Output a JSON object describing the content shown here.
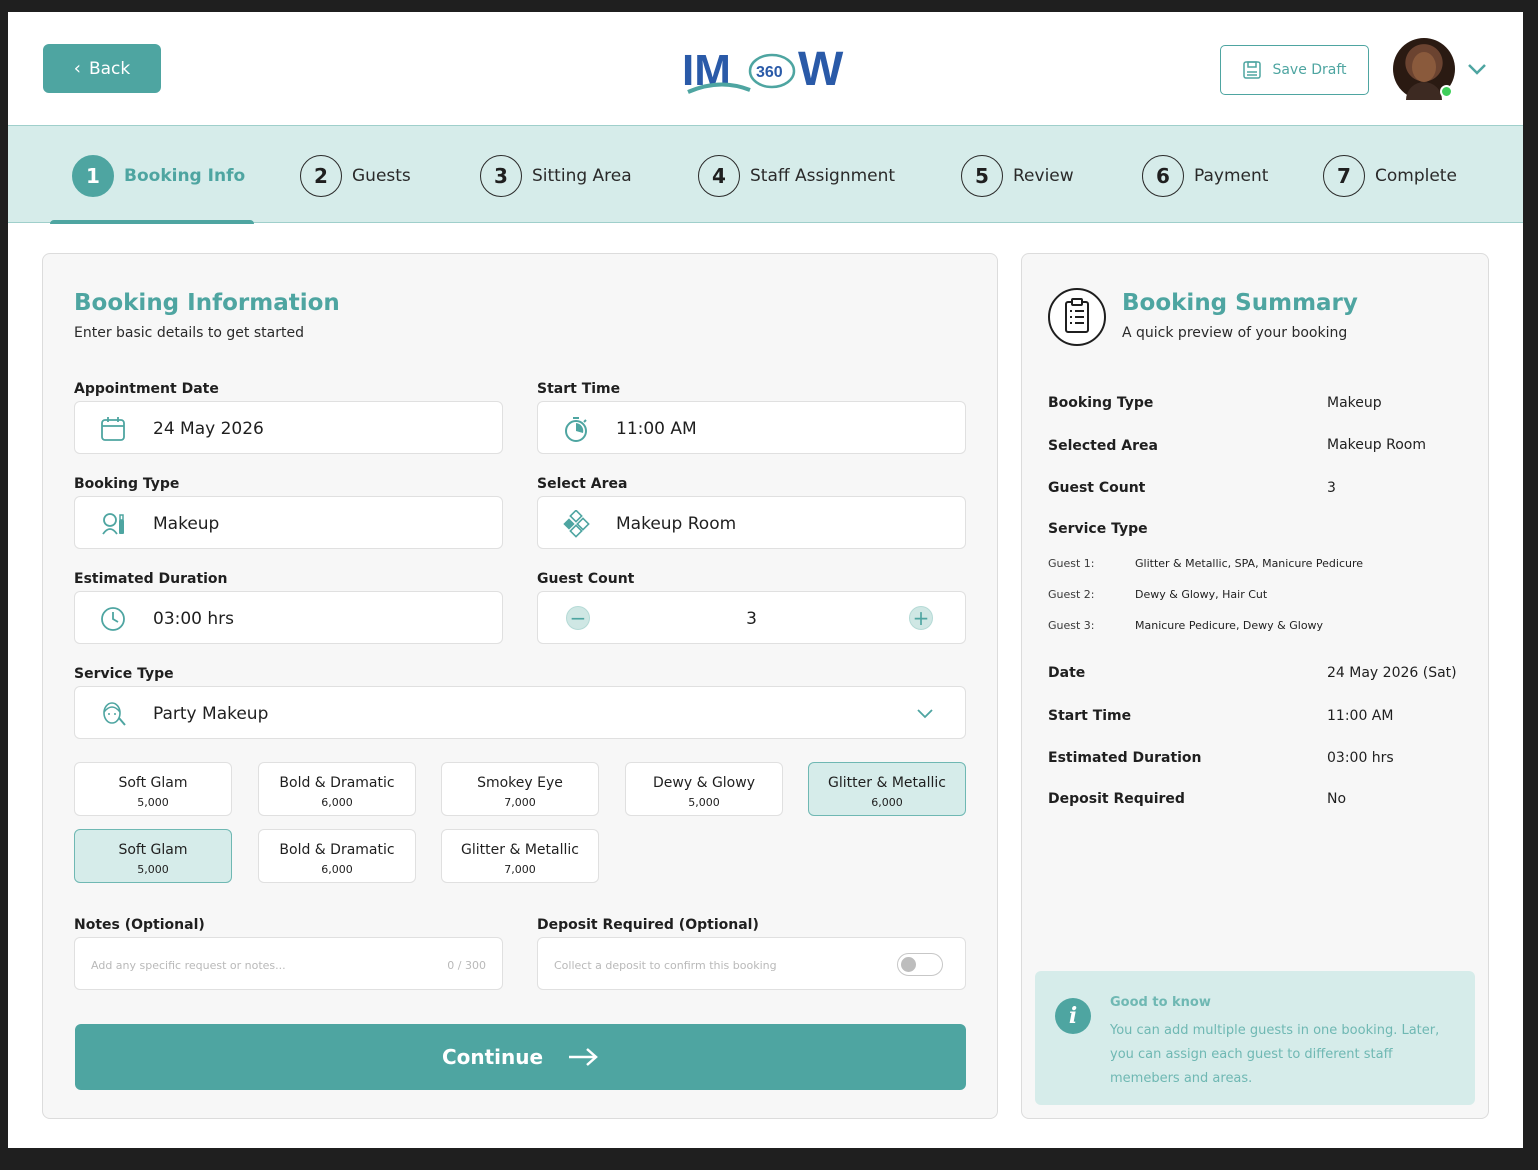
{
  "header": {
    "back_label": "Back",
    "save_draft_label": "Save Draft",
    "logo_left": "IM",
    "logo_badge": "360",
    "logo_right": "W"
  },
  "steps": [
    {
      "num": "1",
      "label": "Booking Info",
      "active": true
    },
    {
      "num": "2",
      "label": "Guests"
    },
    {
      "num": "3",
      "label": "Sitting Area"
    },
    {
      "num": "4",
      "label": "Staff Assignment"
    },
    {
      "num": "5",
      "label": "Review"
    },
    {
      "num": "6",
      "label": "Payment"
    },
    {
      "num": "7",
      "label": "Complete"
    }
  ],
  "form": {
    "title": "Booking Information",
    "subtitle": "Enter basic details to get started",
    "appointment_date_label": "Appointment Date",
    "appointment_date": "24 May 2026",
    "start_time_label": "Start Time",
    "start_time": "11:00 AM",
    "booking_type_label": "Booking Type",
    "booking_type": "Makeup",
    "select_area_label": "Select Area",
    "select_area": "Makeup Room",
    "duration_label": "Estimated Duration",
    "duration": "03:00 hrs",
    "guest_count_label": "Guest Count",
    "guest_count": "3",
    "service_type_label": "Service Type",
    "service_type": "Party Makeup",
    "chips": [
      {
        "name": "Soft Glam",
        "price": "5,000",
        "selected": false
      },
      {
        "name": "Bold & Dramatic",
        "price": "6,000",
        "selected": false
      },
      {
        "name": "Smokey Eye",
        "price": "7,000",
        "selected": false
      },
      {
        "name": "Dewy & Glowy",
        "price": "5,000",
        "selected": false
      },
      {
        "name": "Glitter & Metallic",
        "price": "6,000",
        "selected": true
      },
      {
        "name": "Soft Glam",
        "price": "5,000",
        "selected": true
      },
      {
        "name": "Bold & Dramatic",
        "price": "6,000",
        "selected": false
      },
      {
        "name": "Glitter & Metallic",
        "price": "7,000",
        "selected": false
      }
    ],
    "notes_label": "Notes (Optional)",
    "notes_placeholder": "Add any specific request or notes...",
    "notes_count": "0 / 300",
    "deposit_label": "Deposit Required (Optional)",
    "deposit_placeholder": "Collect a deposit to confirm this booking",
    "deposit_enabled": false,
    "continue_label": "Continue"
  },
  "summary": {
    "title": "Booking Summary",
    "subtitle": "A quick preview of your booking",
    "booking_type_label": "Booking Type",
    "booking_type": "Makeup",
    "selected_area_label": "Selected Area",
    "selected_area": "Makeup Room",
    "guest_count_label": "Guest Count",
    "guest_count": "3",
    "service_type_label": "Service Type",
    "guests": [
      {
        "label": "Guest 1:",
        "services": "Glitter & Metallic, SPA, Manicure Pedicure"
      },
      {
        "label": "Guest 2:",
        "services": "Dewy & Glowy, Hair Cut"
      },
      {
        "label": "Guest 3:",
        "services": "Manicure Pedicure, Dewy & Glowy"
      }
    ],
    "date_label": "Date",
    "date": "24 May 2026 (Sat)",
    "start_time_label": "Start Time",
    "start_time": "11:00 AM",
    "duration_label": "Estimated Duration",
    "duration": "03:00 hrs",
    "deposit_label": "Deposit Required",
    "deposit": "No",
    "info_title": "Good to know",
    "info_text": "You can add multiple guests in one booking. Later, you can assign each guest to different staff memebers and areas."
  },
  "colors": {
    "accent": "#4ea5a1",
    "accent_light": "#d6ecea",
    "online": "#3fcf5a"
  }
}
